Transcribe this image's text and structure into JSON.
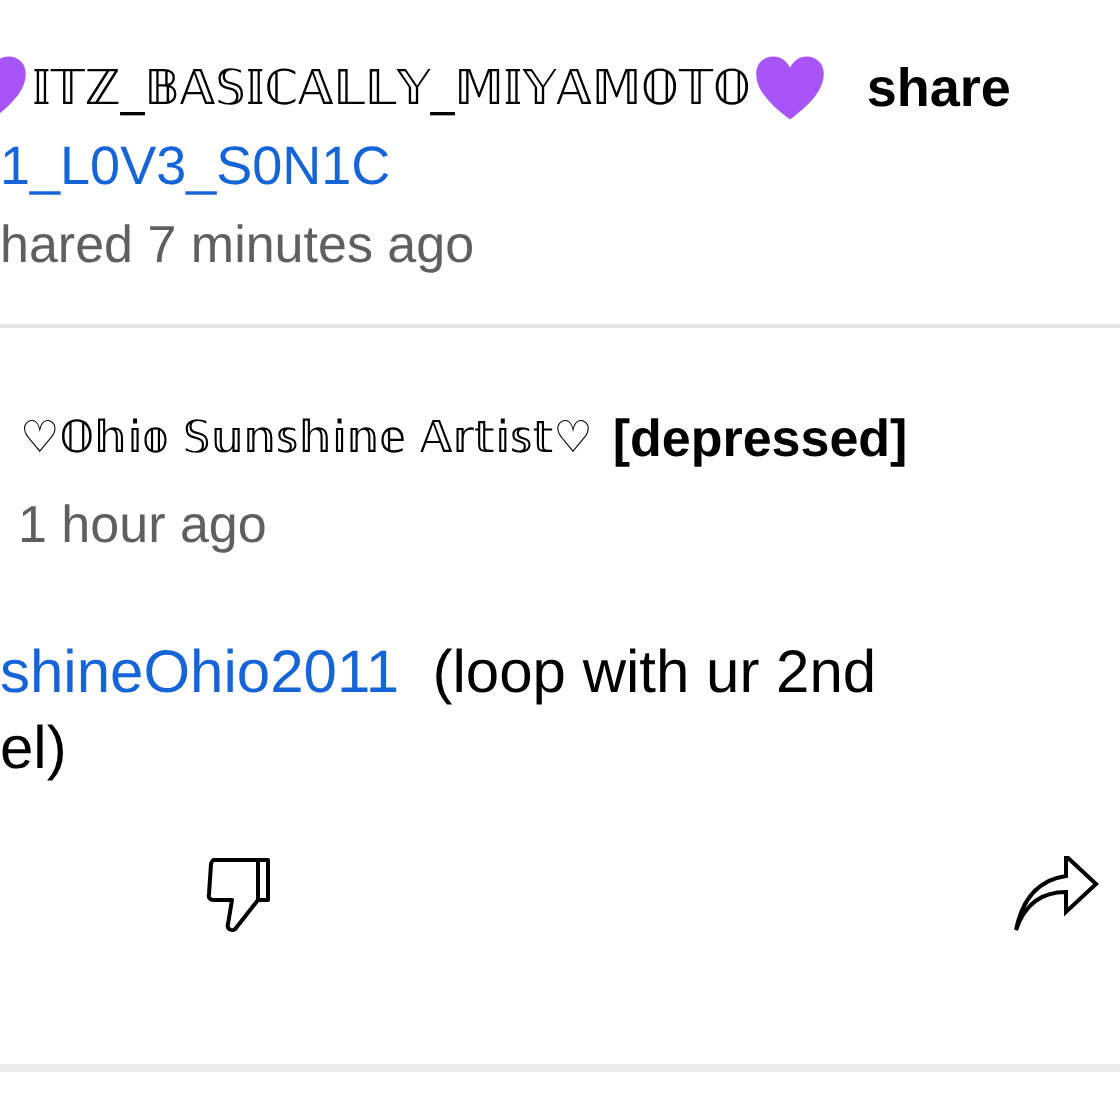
{
  "shared_post": {
    "sharer_name": "𝕀𝕋ℤ_𝔹𝔸𝕊𝕀ℂ𝔸𝕃𝕃𝕐_𝕄𝕀𝕐𝔸𝕄𝕆𝕋𝕆",
    "action": "share",
    "original_author": "1_L0V3_S0N1C",
    "timestamp": "hared 7 minutes ago"
  },
  "comment": {
    "author": "♡𝕆𝕙𝕚𝕠 𝕊𝕦𝕟𝕤𝕙𝕚𝕟𝕖 𝔸𝕣𝕥𝕚𝕤𝕥♡",
    "flair": "[depressed]",
    "timestamp": "1 hour ago",
    "mention": "shineOhio2011",
    "text": "(loop with ur 2nd",
    "continuation": "el)"
  }
}
